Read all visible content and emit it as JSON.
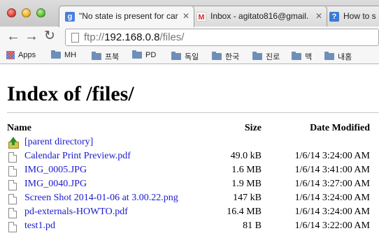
{
  "tabs": [
    {
      "favicon": "google-icon",
      "title": "\"No state is present for car",
      "active": true
    },
    {
      "favicon": "gmail-icon",
      "title": "Inbox - agitato816@gmail.",
      "active": false
    },
    {
      "favicon": "help-icon",
      "title": "How to s",
      "active": false
    }
  ],
  "omnibox": {
    "scheme": "ftp://",
    "host": "192.168.0.8",
    "path": "/files/"
  },
  "bookmarks": [
    {
      "label": "Apps",
      "icon": "apps-icon"
    },
    {
      "label": "MH",
      "icon": "folder-icon"
    },
    {
      "label": "프북",
      "icon": "folder-icon"
    },
    {
      "label": "PD",
      "icon": "folder-icon"
    },
    {
      "label": "독일",
      "icon": "folder-icon"
    },
    {
      "label": "한국",
      "icon": "folder-icon"
    },
    {
      "label": "진로",
      "icon": "folder-icon"
    },
    {
      "label": "맥",
      "icon": "folder-icon"
    },
    {
      "label": "내홈",
      "icon": "folder-icon"
    }
  ],
  "page": {
    "title": "Index of /files/",
    "columns": {
      "name": "Name",
      "size": "Size",
      "date": "Date Modified"
    },
    "parent": {
      "name": "[parent directory]"
    },
    "files": [
      {
        "name": "Calendar Print Preview.pdf",
        "size": "49.0 kB",
        "date": "1/6/14 3:24:00 AM"
      },
      {
        "name": "IMG_0005.JPG",
        "size": "1.6 MB",
        "date": "1/6/14 3:41:00 AM"
      },
      {
        "name": "IMG_0040.JPG",
        "size": "1.9 MB",
        "date": "1/6/14 3:27:00 AM"
      },
      {
        "name": "Screen Shot 2014-01-06 at 3.00.22.png",
        "size": "147 kB",
        "date": "1/6/14 3:24:00 AM"
      },
      {
        "name": "pd-externals-HOWTO.pdf",
        "size": "16.4 MB",
        "date": "1/6/14 3:24:00 AM"
      },
      {
        "name": "test1.pd",
        "size": "81 B",
        "date": "1/6/14 3:22:00 AM"
      }
    ]
  },
  "colors": {
    "link": "#1a1ad0",
    "google_blue": "#4a7fe0",
    "gmail_red": "#d93025"
  }
}
